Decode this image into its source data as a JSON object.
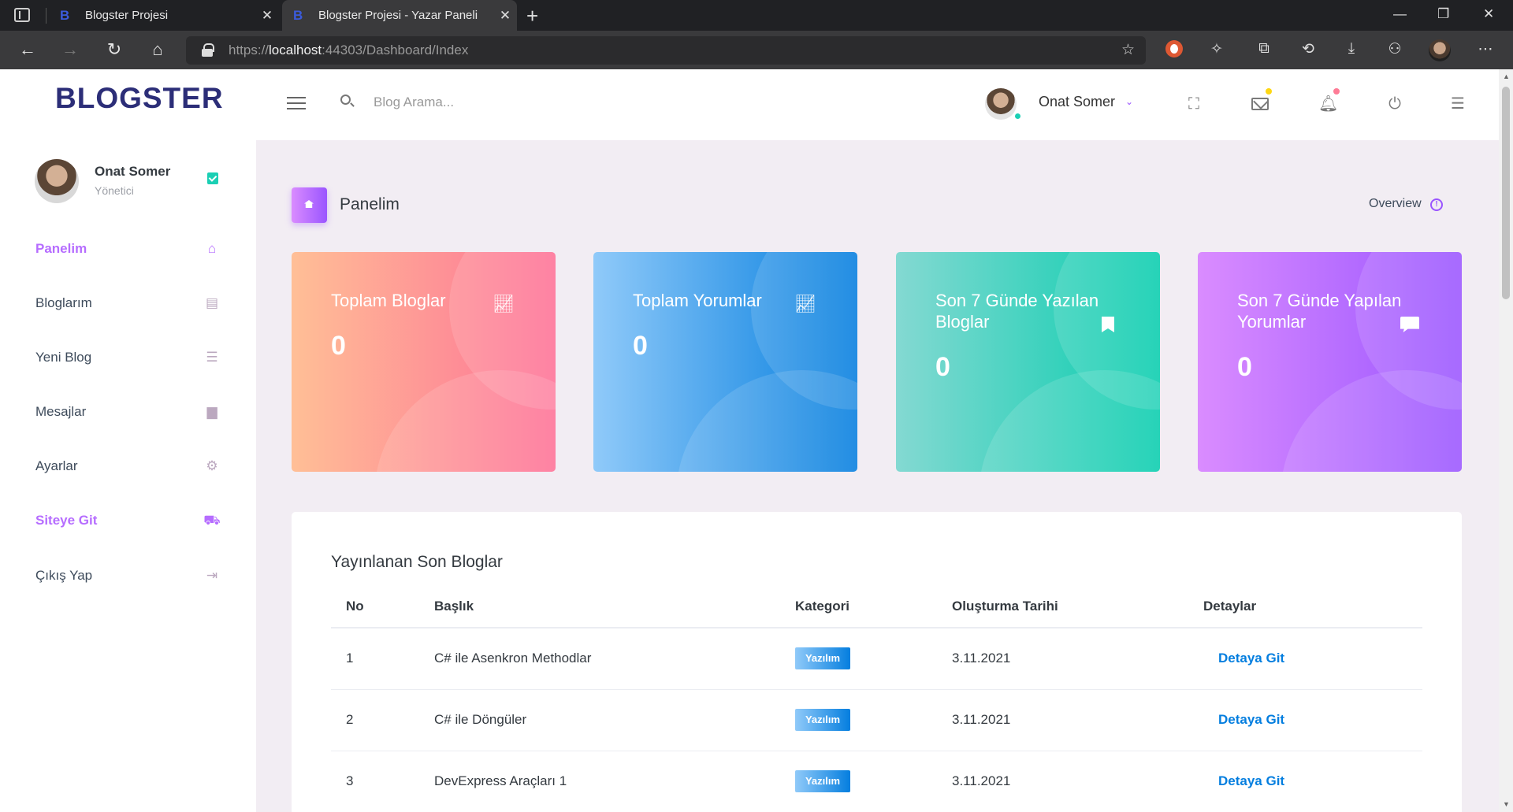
{
  "browser": {
    "tabs": [
      {
        "label": "Blogster Projesi",
        "favicon": "B",
        "active": false
      },
      {
        "label": "Blogster Projesi - Yazar Paneli",
        "favicon": "B",
        "active": true
      }
    ],
    "url_prefix": "https://",
    "url_host": "localhost",
    "url_path": ":44303/Dashboard/Index"
  },
  "header": {
    "brand": "BLOGSTER",
    "search_placeholder": "Blog Arama...",
    "user_name": "Onat Somer"
  },
  "sidebar": {
    "profile_name": "Onat Somer",
    "profile_role": "Yönetici",
    "items": [
      {
        "label": "Panelim",
        "icon": "home-icon"
      },
      {
        "label": "Bloglarım",
        "icon": "contacts-icon"
      },
      {
        "label": "Yeni Blog",
        "icon": "list-icon"
      },
      {
        "label": "Mesajlar",
        "icon": "message-icon"
      },
      {
        "label": "Ayarlar",
        "icon": "gear-icon"
      },
      {
        "label": "Siteye Git",
        "icon": "car-icon"
      },
      {
        "label": "Çıkış Yap",
        "icon": "logout-icon"
      }
    ]
  },
  "page": {
    "title": "Panelim",
    "overview": "Overview"
  },
  "stats": [
    {
      "title": "Toplam Bloglar",
      "value": "0",
      "icon": "chart-line-icon",
      "color_from": "#ffbf96",
      "color_to": "#fe7096"
    },
    {
      "title": "Toplam Yorumlar",
      "value": "0",
      "icon": "chart-line-icon",
      "color_from": "#90caf9",
      "color_to": "#047edf"
    },
    {
      "title": "Son 7 Günde Yazılan Bloglar",
      "value": "0",
      "icon": "bookmark-icon",
      "color_from": "#84d9d2",
      "color_to": "#07cdae"
    },
    {
      "title": "Son 7 Günde Yapılan Yorumlar",
      "value": "0",
      "icon": "chat-icon",
      "color_from": "#da8cff",
      "color_to": "#9a55ff"
    }
  ],
  "recent": {
    "title": "Yayınlanan Son Bloglar",
    "columns": [
      "No",
      "Başlık",
      "Kategori",
      "Oluşturma Tarihi",
      "Detaylar"
    ],
    "rows": [
      {
        "no": "1",
        "title": "C# ile Asenkron Methodlar",
        "category": "Yazılım",
        "date": "3.11.2021",
        "detail": "Detaya Git"
      },
      {
        "no": "2",
        "title": "C# ile Döngüler",
        "category": "Yazılım",
        "date": "3.11.2021",
        "detail": "Detaya Git"
      },
      {
        "no": "3",
        "title": "DevExpress Araçları 1",
        "category": "Yazılım",
        "date": "3.11.2021",
        "detail": "Detaya Git"
      }
    ]
  }
}
